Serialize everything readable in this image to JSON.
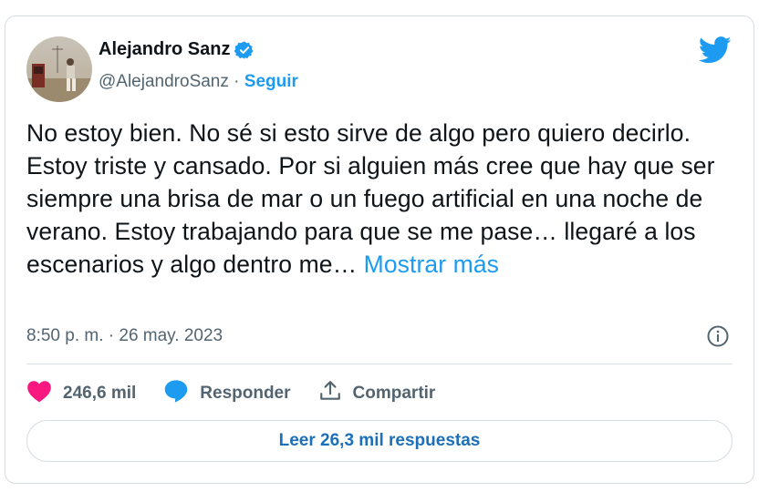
{
  "author": {
    "name": "Alejandro Sanz",
    "handle": "@AlejandroSanz",
    "separator": "·",
    "follow_label": "Seguir",
    "verified_icon": "verified-badge-icon"
  },
  "tweet": {
    "text": "No estoy bien. No sé si esto sirve de algo pero quiero decirlo. Estoy triste y cansado. Por si alguien más cree que hay que ser siempre una brisa de mar o un fuego artificial en una noche de verano. Estoy trabajando para que se me pase… llegaré a los escenarios y algo dentro me… ",
    "more_label": "Mostrar más",
    "timestamp": "8:50 p. m. · 26 may. 2023"
  },
  "actions": {
    "likes": "246,6 mil",
    "reply_label": "Responder",
    "share_label": "Compartir"
  },
  "read_replies_label": "Leer 26,3 mil respuestas",
  "colors": {
    "accent": "#1d9bf0",
    "like": "#f91880",
    "text": "#0f1419",
    "muted": "#536471"
  }
}
